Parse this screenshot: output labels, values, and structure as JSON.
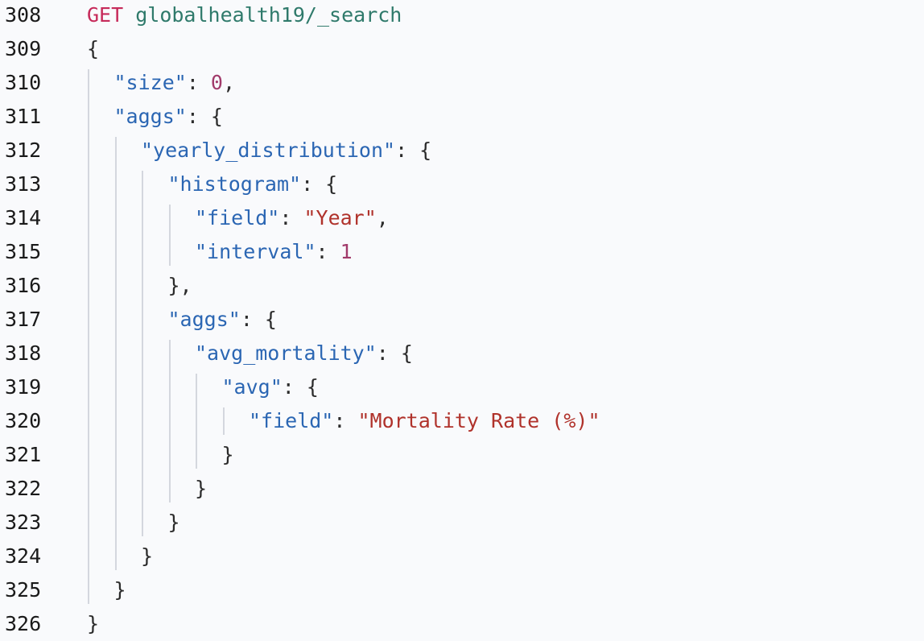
{
  "editor": {
    "lines": [
      {
        "number": "308",
        "indent": 0,
        "tokens": [
          {
            "text": "GET",
            "t": "method"
          },
          {
            "text": " ",
            "t": "punct"
          },
          {
            "text": "globalhealth19/_search",
            "t": "path"
          }
        ]
      },
      {
        "number": "309",
        "indent": 0,
        "tokens": [
          {
            "text": "{",
            "t": "punct"
          }
        ]
      },
      {
        "number": "310",
        "indent": 1,
        "tokens": [
          {
            "text": "\"size\"",
            "t": "key"
          },
          {
            "text": ": ",
            "t": "punct"
          },
          {
            "text": "0",
            "t": "num"
          },
          {
            "text": ",",
            "t": "punct"
          }
        ]
      },
      {
        "number": "311",
        "indent": 1,
        "tokens": [
          {
            "text": "\"aggs\"",
            "t": "key"
          },
          {
            "text": ": {",
            "t": "punct"
          }
        ]
      },
      {
        "number": "312",
        "indent": 2,
        "tokens": [
          {
            "text": "\"yearly_distribution\"",
            "t": "key"
          },
          {
            "text": ": {",
            "t": "punct"
          }
        ]
      },
      {
        "number": "313",
        "indent": 3,
        "tokens": [
          {
            "text": "\"histogram\"",
            "t": "key"
          },
          {
            "text": ": {",
            "t": "punct"
          }
        ]
      },
      {
        "number": "314",
        "indent": 4,
        "tokens": [
          {
            "text": "\"field\"",
            "t": "key"
          },
          {
            "text": ": ",
            "t": "punct"
          },
          {
            "text": "\"Year\"",
            "t": "str"
          },
          {
            "text": ",",
            "t": "punct"
          }
        ]
      },
      {
        "number": "315",
        "indent": 4,
        "tokens": [
          {
            "text": "\"interval\"",
            "t": "key"
          },
          {
            "text": ": ",
            "t": "punct"
          },
          {
            "text": "1",
            "t": "num"
          }
        ]
      },
      {
        "number": "316",
        "indent": 3,
        "tokens": [
          {
            "text": "},",
            "t": "punct"
          }
        ]
      },
      {
        "number": "317",
        "indent": 3,
        "tokens": [
          {
            "text": "\"aggs\"",
            "t": "key"
          },
          {
            "text": ": {",
            "t": "punct"
          }
        ]
      },
      {
        "number": "318",
        "indent": 4,
        "tokens": [
          {
            "text": "\"avg_mortality\"",
            "t": "key"
          },
          {
            "text": ": {",
            "t": "punct"
          }
        ]
      },
      {
        "number": "319",
        "indent": 5,
        "tokens": [
          {
            "text": "\"avg\"",
            "t": "key"
          },
          {
            "text": ": {",
            "t": "punct"
          }
        ]
      },
      {
        "number": "320",
        "indent": 6,
        "tokens": [
          {
            "text": "\"field\"",
            "t": "key"
          },
          {
            "text": ": ",
            "t": "punct"
          },
          {
            "text": "\"Mortality Rate (%)\"",
            "t": "str"
          }
        ]
      },
      {
        "number": "321",
        "indent": 5,
        "tokens": [
          {
            "text": "}",
            "t": "punct"
          }
        ]
      },
      {
        "number": "322",
        "indent": 4,
        "tokens": [
          {
            "text": "}",
            "t": "punct"
          }
        ]
      },
      {
        "number": "323",
        "indent": 3,
        "tokens": [
          {
            "text": "}",
            "t": "punct"
          }
        ]
      },
      {
        "number": "324",
        "indent": 2,
        "tokens": [
          {
            "text": "}",
            "t": "punct"
          }
        ]
      },
      {
        "number": "325",
        "indent": 1,
        "tokens": [
          {
            "text": "}",
            "t": "punct"
          }
        ]
      },
      {
        "number": "326",
        "indent": 0,
        "tokens": [
          {
            "text": "}",
            "t": "punct"
          }
        ]
      }
    ],
    "colors": {
      "background": "#f9fafc",
      "method": "#c62a5a",
      "path": "#2f7a6b",
      "key": "#2b66b3",
      "number": "#a13a6a",
      "string": "#b0322b",
      "guide": "#d4d7de"
    }
  }
}
